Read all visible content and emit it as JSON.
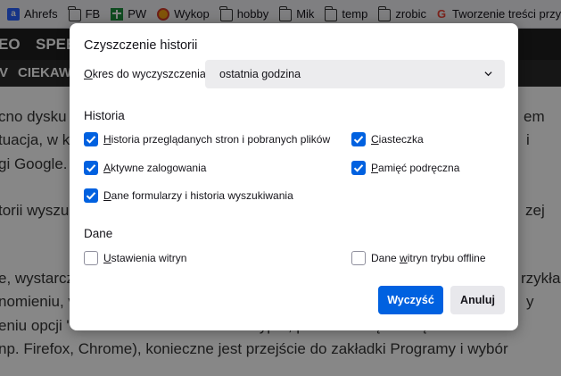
{
  "bookmarks": [
    {
      "label": "Ahrefs",
      "icon": "ahrefs-icon"
    },
    {
      "label": "FB",
      "icon": "folder-icon"
    },
    {
      "label": "PW",
      "icon": "pw-icon"
    },
    {
      "label": "Wykop",
      "icon": "wykop-icon"
    },
    {
      "label": "hobby",
      "icon": "folder-icon"
    },
    {
      "label": "Mik",
      "icon": "folder-icon"
    },
    {
      "label": "temp",
      "icon": "folder-icon"
    },
    {
      "label": "zrobic",
      "icon": "folder-icon"
    },
    {
      "label": "Tworzenie treści przyd...",
      "icon": "google-icon"
    }
  ],
  "background_page": {
    "nav1_items": [
      "EO",
      "SPEE"
    ],
    "nav2_items": [
      "V",
      "CIEKAW"
    ],
    "lines_left": [
      "cno dysku",
      "tuacja, w k",
      "gi Google.",
      "torii wyszu",
      "e, wystarcz",
      "nomieniu, v",
      "eniu opcji \"Cookies\" i uruchomieniu skryptu, pliki zostaną usunięte. W celu",
      "np. Firefox, Chrome), konieczne jest przejście do zakładki Programy i wybór"
    ],
    "lines_right": [
      "em",
      "i",
      "zej",
      "rzykła",
      "y"
    ]
  },
  "dialog": {
    "title": "Czyszczenie historii",
    "range_label_accel": "O",
    "range_label_rest": "kres do wyczyszczenia:",
    "range_value": "ostatnia godzina",
    "history_heading": "Historia",
    "data_heading": "Dane",
    "options": {
      "browsing": {
        "pre": "",
        "acc": "H",
        "post": "istoria przeglądanych stron i pobranych plików",
        "checked": true
      },
      "logins": {
        "pre": "",
        "acc": "A",
        "post": "ktywne zalogowania",
        "checked": true
      },
      "forms": {
        "pre": "",
        "acc": "D",
        "post": "ane formularzy i historia wyszukiwania",
        "checked": true
      },
      "cookies": {
        "pre": "",
        "acc": "C",
        "post": "iasteczka",
        "checked": true
      },
      "cache": {
        "pre": "",
        "acc": "P",
        "post": "amięć podręczna",
        "checked": true
      },
      "site_settings": {
        "pre": "",
        "acc": "U",
        "post": "stawienia witryn",
        "checked": false
      },
      "offline_data": {
        "pre": "Dane ",
        "acc": "w",
        "post": "itryn trybu offline",
        "checked": false
      }
    },
    "clear_button": "Wyczyść",
    "cancel_button": "Anuluj"
  },
  "colors": {
    "accent": "#0061e0",
    "checkbox_border": "#8f8f9d",
    "select_bg": "#ececee"
  }
}
